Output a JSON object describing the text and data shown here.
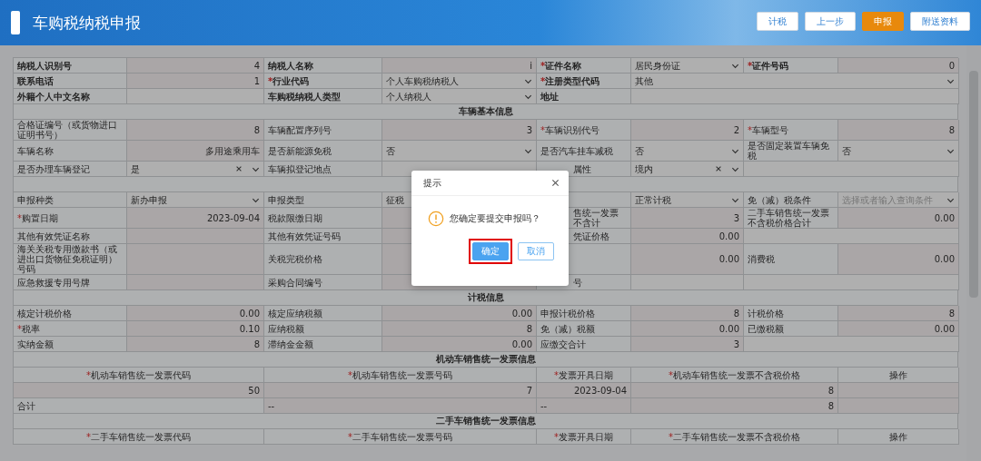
{
  "header": {
    "title": "车购税纳税申报",
    "buttons": [
      {
        "label": "计税",
        "kind": "default"
      },
      {
        "label": "上一步",
        "kind": "default"
      },
      {
        "label": "申报",
        "kind": "primary"
      },
      {
        "label": "附送资料",
        "kind": "default"
      }
    ]
  },
  "form": [
    {
      "kind": "fields",
      "cells": [
        {
          "kind": "key",
          "text": "纳税人识别号"
        },
        {
          "kind": "value",
          "text": "4"
        },
        {
          "kind": "key",
          "text": "纳税人名称"
        },
        {
          "kind": "value",
          "text": "i"
        },
        {
          "kind": "key",
          "mark": "*",
          "text": "证件名称"
        },
        {
          "kind": "select",
          "text": "居民身份证"
        },
        {
          "kind": "key",
          "mark": "*",
          "text": "证件号码"
        },
        {
          "kind": "value",
          "text": "0"
        }
      ]
    },
    {
      "kind": "fields",
      "cells": [
        {
          "kind": "key",
          "text": "联系电话"
        },
        {
          "kind": "value",
          "text": "1"
        },
        {
          "kind": "key",
          "mark": "*",
          "text": "行业代码"
        },
        {
          "kind": "select",
          "text": "个人车购税纳税人"
        },
        {
          "kind": "key",
          "mark": "*",
          "text": "注册类型代码"
        },
        {
          "kind": "select",
          "text": "其他"
        }
      ]
    },
    {
      "kind": "fields",
      "cells": [
        {
          "kind": "key",
          "text": "外籍个人中文名称"
        },
        {
          "kind": "input",
          "text": ""
        },
        {
          "kind": "key",
          "text": "车购税纳税人类型"
        },
        {
          "kind": "select",
          "text": "个人纳税人"
        },
        {
          "kind": "key",
          "text": "地址"
        },
        {
          "kind": "input",
          "text": ""
        }
      ]
    },
    {
      "kind": "section",
      "title": "车辆基本信息"
    },
    {
      "kind": "fields",
      "cells": [
        {
          "kind": "label",
          "text": "合格证编号（或货物进口证明书号）"
        },
        {
          "kind": "value",
          "text": "8"
        },
        {
          "kind": "label",
          "text": "车辆配置序列号"
        },
        {
          "kind": "value",
          "text": "3"
        },
        {
          "kind": "label",
          "mark": "*",
          "text": "车辆识别代号"
        },
        {
          "kind": "value",
          "text": "2"
        },
        {
          "kind": "label",
          "mark": "*",
          "text": "车辆型号"
        },
        {
          "kind": "value",
          "text": "8"
        }
      ]
    },
    {
      "kind": "fields",
      "cells": [
        {
          "kind": "label",
          "text": "车辆名称"
        },
        {
          "kind": "value",
          "text": "多用途乘用车"
        },
        {
          "kind": "label",
          "text": "是否新能源免税"
        },
        {
          "kind": "select",
          "text": "否"
        },
        {
          "kind": "label",
          "text": "是否汽车挂车减税"
        },
        {
          "kind": "select",
          "text": "否"
        },
        {
          "kind": "label",
          "text": "是否固定装置车辆免税"
        },
        {
          "kind": "select",
          "text": "否"
        }
      ]
    },
    {
      "kind": "fields",
      "cells": [
        {
          "kind": "label",
          "text": "是否办理车辆登记"
        },
        {
          "kind": "select",
          "text": "是",
          "clearable": true
        },
        {
          "kind": "label",
          "text": "车辆拟登记地点"
        },
        {
          "kind": "input",
          "text": ""
        },
        {
          "kind": "fragment",
          "text": "属性"
        },
        {
          "kind": "select",
          "text": "境内",
          "clearable": true
        },
        {
          "kind": "input",
          "text": ""
        }
      ]
    },
    {
      "kind": "blank"
    },
    {
      "kind": "fields",
      "cells": [
        {
          "kind": "label",
          "text": "申报种类"
        },
        {
          "kind": "select",
          "text": "新办申报"
        },
        {
          "kind": "label",
          "text": "申报类型"
        },
        {
          "kind": "input",
          "text": "征税"
        },
        {
          "kind": "fragment",
          "text": ""
        },
        {
          "kind": "select",
          "text": "正常计税"
        },
        {
          "kind": "label",
          "text": "免（减）税条件"
        },
        {
          "kind": "select",
          "text": "",
          "placeholder": "选择或者输入查询条件"
        }
      ]
    },
    {
      "kind": "fields",
      "cells": [
        {
          "kind": "label",
          "mark": "*",
          "text": "购置日期"
        },
        {
          "kind": "value",
          "text": "2023-09-04"
        },
        {
          "kind": "label",
          "text": "税款限缴日期"
        },
        {
          "kind": "value",
          "text": ""
        },
        {
          "kind": "fragment",
          "text": "售统一发票不含计"
        },
        {
          "kind": "value",
          "text": "3"
        },
        {
          "kind": "label",
          "text": "二手车销售统一发票不含税价格合计"
        },
        {
          "kind": "value",
          "text": "0.00"
        }
      ]
    },
    {
      "kind": "fields",
      "cells": [
        {
          "kind": "label",
          "text": "其他有效凭证名称"
        },
        {
          "kind": "value",
          "text": ""
        },
        {
          "kind": "label",
          "text": "其他有效凭证号码"
        },
        {
          "kind": "value",
          "text": ""
        },
        {
          "kind": "fragment",
          "text": "凭证价格"
        },
        {
          "kind": "value",
          "text": "0.00"
        },
        {
          "kind": "input",
          "text": ""
        }
      ]
    },
    {
      "kind": "fields",
      "cells": [
        {
          "kind": "label",
          "text": "海关关税专用缴款书（或进出口货物征免税证明）号码"
        },
        {
          "kind": "value",
          "text": ""
        },
        {
          "kind": "label",
          "text": "关税完税价格"
        },
        {
          "kind": "value",
          "text": ""
        },
        {
          "kind": "fragment",
          "text": ""
        },
        {
          "kind": "value",
          "text": "0.00"
        },
        {
          "kind": "label",
          "text": "消费税"
        },
        {
          "kind": "value",
          "text": "0.00"
        }
      ]
    },
    {
      "kind": "fields",
      "cells": [
        {
          "kind": "label",
          "text": "应急救援专用号牌"
        },
        {
          "kind": "value",
          "text": ""
        },
        {
          "kind": "label",
          "text": "采购合同编号"
        },
        {
          "kind": "value",
          "text": ""
        },
        {
          "kind": "fragment",
          "text": "号"
        },
        {
          "kind": "input",
          "text": ""
        },
        {
          "kind": "input",
          "text": ""
        }
      ]
    },
    {
      "kind": "section",
      "title": "计税信息"
    },
    {
      "kind": "fields",
      "cells": [
        {
          "kind": "label",
          "text": "核定计税价格"
        },
        {
          "kind": "value",
          "text": "0.00"
        },
        {
          "kind": "label",
          "text": "核定应纳税额"
        },
        {
          "kind": "value",
          "text": "0.00"
        },
        {
          "kind": "label",
          "text": "申报计税价格"
        },
        {
          "kind": "value",
          "text": "8"
        },
        {
          "kind": "label",
          "text": "计税价格"
        },
        {
          "kind": "value",
          "text": "8"
        }
      ]
    },
    {
      "kind": "fields",
      "cells": [
        {
          "kind": "label",
          "mark": "*",
          "text": "税率"
        },
        {
          "kind": "value",
          "text": "0.10"
        },
        {
          "kind": "label",
          "text": "应纳税额"
        },
        {
          "kind": "value",
          "text": "8"
        },
        {
          "kind": "label",
          "text": "免（减）税额"
        },
        {
          "kind": "value",
          "text": "0.00"
        },
        {
          "kind": "label",
          "text": "已缴税额"
        },
        {
          "kind": "value",
          "text": "0.00"
        }
      ]
    },
    {
      "kind": "fields",
      "cells": [
        {
          "kind": "label",
          "text": "实纳金额"
        },
        {
          "kind": "value",
          "text": "8"
        },
        {
          "kind": "label",
          "text": "滞纳金金额"
        },
        {
          "kind": "value",
          "text": "0.00"
        },
        {
          "kind": "label",
          "text": "应缴交合计"
        },
        {
          "kind": "value",
          "text": "3"
        },
        {
          "kind": "input",
          "text": ""
        }
      ]
    },
    {
      "kind": "section",
      "title": "机动车销售统一发票信息"
    },
    {
      "kind": "fields",
      "cells": [
        {
          "kind": "head",
          "mark": "*",
          "text": "机动车销售统一发票代码"
        },
        {
          "kind": "head",
          "mark": "*",
          "text": "机动车销售统一发票号码"
        },
        {
          "kind": "head",
          "mark": "*",
          "text": "发票开具日期"
        },
        {
          "kind": "head",
          "mark": "*",
          "text": "机动车销售统一发票不含税价格"
        },
        {
          "kind": "head",
          "text": "操作"
        }
      ]
    },
    {
      "kind": "fields",
      "cells": [
        {
          "kind": "value",
          "text": "50"
        },
        {
          "kind": "value",
          "text": "7"
        },
        {
          "kind": "value",
          "text": "2023-09-04"
        },
        {
          "kind": "value",
          "text": "8"
        },
        {
          "kind": "value",
          "text": ""
        }
      ]
    },
    {
      "kind": "fields",
      "cells": [
        {
          "kind": "label",
          "text": "合计"
        },
        {
          "kind": "value_left",
          "text": "--"
        },
        {
          "kind": "value_left",
          "text": "--"
        },
        {
          "kind": "value",
          "text": "8"
        },
        {
          "kind": "value",
          "text": ""
        }
      ]
    },
    {
      "kind": "section",
      "title": "二手车销售统一发票信息"
    },
    {
      "kind": "fields",
      "cells": [
        {
          "kind": "head",
          "mark": "*",
          "text": "二手车销售统一发票代码"
        },
        {
          "kind": "head",
          "mark": "*",
          "text": "二手车销售统一发票号码"
        },
        {
          "kind": "head",
          "mark": "*",
          "text": "发票开具日期"
        },
        {
          "kind": "head",
          "mark": "*",
          "text": "二手车销售统一发票不含税价格"
        },
        {
          "kind": "head",
          "text": "操作"
        }
      ]
    }
  ],
  "dialog": {
    "title": "提示",
    "message": "您确定要提交申报吗？",
    "buttons": [
      {
        "label": "确定",
        "kind": "primary",
        "highlighted": true
      },
      {
        "label": "取消",
        "kind": "default",
        "highlighted": false
      }
    ]
  }
}
